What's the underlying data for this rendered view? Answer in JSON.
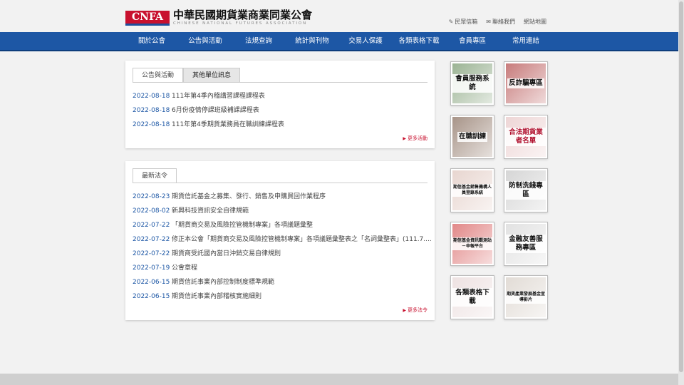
{
  "header": {
    "logo_abbr": "CNFA",
    "org_name_cn": "中華民國期貨業商業同業公會",
    "org_name_en": "CHINESE NATIONAL FUTURES ASSOCIATION",
    "util_links": [
      {
        "label": "民眾信箱",
        "icon": "mailbox-icon"
      },
      {
        "label": "聯絡我們",
        "icon": "envelope-icon"
      },
      {
        "label": "網站地圖",
        "icon": ""
      }
    ]
  },
  "nav": {
    "items": [
      "關於公會",
      "公告與活動",
      "法規查詢",
      "統計與刊物",
      "交易人保護",
      "各類表格下載",
      "會員專區",
      "常用連結"
    ]
  },
  "announcements": {
    "tabs": [
      "公告與活動",
      "其他單位訊息"
    ],
    "rows": [
      {
        "date": "2022-08-18",
        "title": "111年第4季內稽講習課程課程表"
      },
      {
        "date": "2022-08-18",
        "title": "6月份疫情停課班級補課課程表"
      },
      {
        "date": "2022-08-18",
        "title": "111年第4季期貨業務員在職訓練課程表"
      }
    ],
    "more_label": "更多活動"
  },
  "regulations": {
    "tabs": [
      "最新法令"
    ],
    "rows": [
      {
        "date": "2022-08-23",
        "title": "期貨信託基金之募集、發行、銷售及申購買回作業程序"
      },
      {
        "date": "2022-08-02",
        "title": "新興科技資訊安全自律規範"
      },
      {
        "date": "2022-07-22",
        "title": "「期貨商交易及風險控管機制專案」各項議題彙整"
      },
      {
        "date": "2022-07-22",
        "title": "修正本公會「期貨商交易及風險控管機制專案」各項議題彙整表之「名詞彙整表」(111.7...."
      },
      {
        "date": "2022-07-22",
        "title": "期貨商受託國內當日沖銷交易自律規則"
      },
      {
        "date": "2022-07-19",
        "title": "公會章程"
      },
      {
        "date": "2022-06-15",
        "title": "期貨信託事業內部控制制度標準規範"
      },
      {
        "date": "2022-06-15",
        "title": "期貨信託事業內部稽核實施細則"
      }
    ],
    "more_label": "更多法令"
  },
  "tiles": [
    {
      "label": "會員服務系統",
      "bg": "#7a9a70"
    },
    {
      "label": "反詐騙專區",
      "bg": "#b55050"
    },
    {
      "label": "在職訓練",
      "bg": "#8a7060"
    },
    {
      "label": "合法期貨業者名單",
      "bg": "#e8c8c8"
    },
    {
      "label": "期信基金銷售機構人員登錄系統",
      "bg": "#e0c8c0"
    },
    {
      "label": "防制洗錢專區",
      "bg": "#c8c8c8"
    },
    {
      "label": "期信基金資訊觀測站－申報平台",
      "bg": "#d86060"
    },
    {
      "label": "金融友善服務專區",
      "bg": "#d8d8d8"
    },
    {
      "label": "各類表格下載",
      "bg": "#e8d8d8"
    },
    {
      "label": "期貨產業發展基金宣導影片",
      "bg": "#d8d0c8"
    }
  ]
}
